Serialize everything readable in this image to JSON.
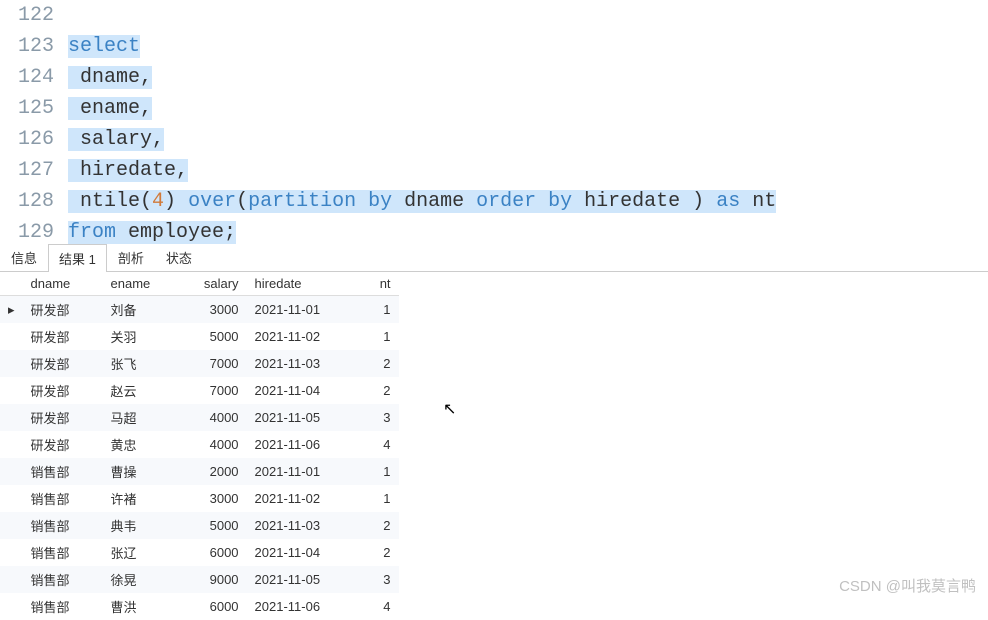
{
  "code": {
    "lines": [
      {
        "num": "122",
        "tokens": ""
      },
      {
        "num": "123",
        "tokens": "select"
      },
      {
        "num": "124",
        "tokens": " dname,"
      },
      {
        "num": "125",
        "tokens": " ename,"
      },
      {
        "num": "126",
        "tokens": " salary,"
      },
      {
        "num": "127",
        "tokens": " hiredate,"
      },
      {
        "num": "128",
        "tokens": " ntile(4) over(partition by dname order by hiredate ) as nt"
      },
      {
        "num": "129",
        "tokens": "from employee;"
      }
    ]
  },
  "tabs": {
    "items": [
      "信息",
      "结果 1",
      "剖析",
      "状态"
    ],
    "active": 1
  },
  "table": {
    "columns": [
      "dname",
      "ename",
      "salary",
      "hiredate",
      "nt"
    ],
    "rows": [
      {
        "marker": "▸",
        "dname": "研发部",
        "ename": "刘备",
        "salary": "3000",
        "hiredate": "2021-11-01",
        "nt": "1"
      },
      {
        "marker": "",
        "dname": "研发部",
        "ename": "关羽",
        "salary": "5000",
        "hiredate": "2021-11-02",
        "nt": "1"
      },
      {
        "marker": "",
        "dname": "研发部",
        "ename": "张飞",
        "salary": "7000",
        "hiredate": "2021-11-03",
        "nt": "2"
      },
      {
        "marker": "",
        "dname": "研发部",
        "ename": "赵云",
        "salary": "7000",
        "hiredate": "2021-11-04",
        "nt": "2"
      },
      {
        "marker": "",
        "dname": "研发部",
        "ename": "马超",
        "salary": "4000",
        "hiredate": "2021-11-05",
        "nt": "3"
      },
      {
        "marker": "",
        "dname": "研发部",
        "ename": "黄忠",
        "salary": "4000",
        "hiredate": "2021-11-06",
        "nt": "4"
      },
      {
        "marker": "",
        "dname": "销售部",
        "ename": "曹操",
        "salary": "2000",
        "hiredate": "2021-11-01",
        "nt": "1"
      },
      {
        "marker": "",
        "dname": "销售部",
        "ename": "许褚",
        "salary": "3000",
        "hiredate": "2021-11-02",
        "nt": "1"
      },
      {
        "marker": "",
        "dname": "销售部",
        "ename": "典韦",
        "salary": "5000",
        "hiredate": "2021-11-03",
        "nt": "2"
      },
      {
        "marker": "",
        "dname": "销售部",
        "ename": "张辽",
        "salary": "6000",
        "hiredate": "2021-11-04",
        "nt": "2"
      },
      {
        "marker": "",
        "dname": "销售部",
        "ename": "徐晃",
        "salary": "9000",
        "hiredate": "2021-11-05",
        "nt": "3"
      },
      {
        "marker": "",
        "dname": "销售部",
        "ename": "曹洪",
        "salary": "6000",
        "hiredate": "2021-11-06",
        "nt": "4"
      }
    ]
  },
  "watermark": "CSDN @叫我莫言鸭"
}
